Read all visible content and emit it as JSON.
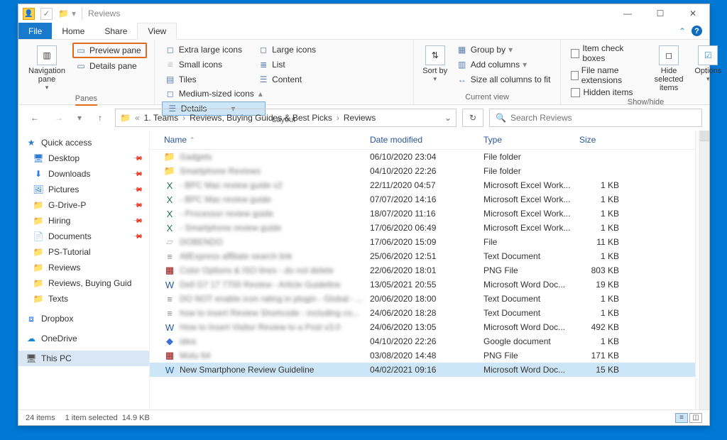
{
  "titlebar": {
    "title": "Reviews"
  },
  "menu": {
    "file": "File",
    "home": "Home",
    "share": "Share",
    "view": "View"
  },
  "ribbon": {
    "panes": {
      "navigation": "Navigation pane",
      "preview": "Preview pane",
      "details": "Details pane",
      "label": "Panes"
    },
    "layout": {
      "extra_large": "Extra large icons",
      "large": "Large icons",
      "medium": "Medium-sized icons",
      "small": "Small icons",
      "list": "List",
      "details": "Details",
      "tiles": "Tiles",
      "content": "Content",
      "label": "Layout"
    },
    "current": {
      "sort": "Sort by",
      "group": "Group by",
      "add_cols": "Add columns",
      "size_cols": "Size all columns to fit",
      "label": "Current view"
    },
    "showhide": {
      "check_boxes": "Item check boxes",
      "ext": "File name extensions",
      "hidden": "Hidden items",
      "hide_sel": "Hide selected items",
      "options": "Options",
      "label": "Show/hide"
    }
  },
  "breadcrumb": {
    "a": "1. Teams",
    "b": "Reviews, Buying Guides & Best Picks",
    "c": "Reviews"
  },
  "search": {
    "placeholder": "Search Reviews"
  },
  "columns": {
    "name": "Name",
    "date": "Date modified",
    "type": "Type",
    "size": "Size"
  },
  "tree": {
    "quick": "Quick access",
    "desktop": "Desktop",
    "downloads": "Downloads",
    "pictures": "Pictures",
    "gdrive": "G-Drive-P",
    "hiring": "Hiring",
    "documents": "Documents",
    "ps": "PS-Tutorial",
    "reviews": "Reviews",
    "reviews_long": "Reviews, Buying Guid",
    "texts": "Texts",
    "dropbox": "Dropbox",
    "onedrive": "OneDrive",
    "thispc": "This PC"
  },
  "rows": [
    {
      "icon": "📁",
      "name": "Gadgets",
      "blur": true,
      "date": "06/10/2020 23:04",
      "type": "File folder",
      "size": ""
    },
    {
      "icon": "📁",
      "name": "Smartphone Reviews",
      "blur": true,
      "date": "04/10/2020 22:26",
      "type": "File folder",
      "size": ""
    },
    {
      "icon": "X",
      "iclr": "#217346",
      "name": "- BPC Mac review guide v2",
      "blur": true,
      "date": "22/11/2020 04:57",
      "type": "Microsoft Excel Work...",
      "size": "1 KB"
    },
    {
      "icon": "X",
      "iclr": "#217346",
      "name": "- BPC Mac review guide",
      "blur": true,
      "date": "07/07/2020 14:16",
      "type": "Microsoft Excel Work...",
      "size": "1 KB"
    },
    {
      "icon": "X",
      "iclr": "#217346",
      "name": "- Processor review guide",
      "blur": true,
      "date": "18/07/2020 11:16",
      "type": "Microsoft Excel Work...",
      "size": "1 KB"
    },
    {
      "icon": "X",
      "iclr": "#217346",
      "name": "- Smartphone review guide",
      "blur": true,
      "date": "17/06/2020 06:49",
      "type": "Microsoft Excel Work...",
      "size": "1 KB"
    },
    {
      "icon": "▱",
      "iclr": "#bbb",
      "name": "DOBENDO",
      "blur": true,
      "date": "17/06/2020 15:09",
      "type": "File",
      "size": "11 KB"
    },
    {
      "icon": "≡",
      "iclr": "#888",
      "name": "AllExpress affiliate search link",
      "blur": true,
      "date": "25/06/2020 12:51",
      "type": "Text Document",
      "size": "1 KB"
    },
    {
      "icon": "▦",
      "iclr": "#8b0000",
      "name": "Color Options & ISO lines - do not delete",
      "blur": true,
      "date": "22/06/2020 18:01",
      "type": "PNG File",
      "size": "803 KB"
    },
    {
      "icon": "W",
      "iclr": "#2b579a",
      "name": "Dell G7 17 7700 Review - Article Guideline",
      "blur": true,
      "date": "13/05/2021 20:55",
      "type": "Microsoft Word Doc...",
      "size": "19 KB"
    },
    {
      "icon": "≡",
      "iclr": "#888",
      "name": "DO NOT enable icon rating in plugin - Global - ...",
      "blur": true,
      "date": "20/06/2020 18:00",
      "type": "Text Document",
      "size": "1 KB"
    },
    {
      "icon": "≡",
      "iclr": "#888",
      "name": "how to insert Review Shortcode - including co...",
      "blur": true,
      "date": "24/06/2020 18:28",
      "type": "Text Document",
      "size": "1 KB"
    },
    {
      "icon": "W",
      "iclr": "#2b579a",
      "name": "How to Insert Visitor Review to a Post v3.0",
      "blur": true,
      "date": "24/06/2020 13:05",
      "type": "Microsoft Word Doc...",
      "size": "492 KB"
    },
    {
      "icon": "◆",
      "iclr": "#3871d8",
      "name": "idea",
      "blur": true,
      "date": "04/10/2020 22:26",
      "type": "Google document",
      "size": "1 KB"
    },
    {
      "icon": "▦",
      "iclr": "#8b0000",
      "name": "Motu 64",
      "blur": true,
      "date": "03/08/2020 14:48",
      "type": "PNG File",
      "size": "171 KB"
    },
    {
      "icon": "W",
      "iclr": "#2b579a",
      "name": "New Smartphone Review Guideline",
      "blur": false,
      "sel": true,
      "date": "04/02/2021 09:16",
      "type": "Microsoft Word Doc...",
      "size": "15 KB"
    }
  ],
  "status": {
    "items": "24 items",
    "selected": "1 item selected",
    "size": "14.9 KB"
  }
}
